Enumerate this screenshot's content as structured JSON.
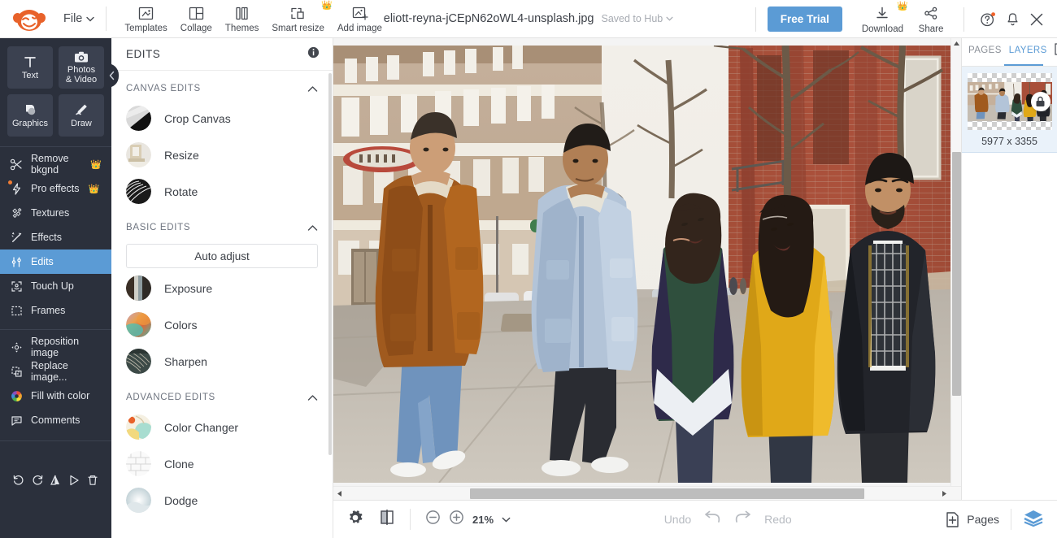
{
  "app": {
    "name": "PicMonkey",
    "logo_icon": "monkey-logo"
  },
  "topbar": {
    "file_menu": "File",
    "file_caret_icon": "chevron-down-icon",
    "tools": [
      {
        "label": "Templates",
        "icon": "templates-icon",
        "pro": false
      },
      {
        "label": "Collage",
        "icon": "collage-icon",
        "pro": false
      },
      {
        "label": "Themes",
        "icon": "themes-icon",
        "pro": false
      },
      {
        "label": "Smart resize",
        "icon": "smart-resize-icon",
        "pro": true
      },
      {
        "label": "Add image",
        "icon": "add-image-icon",
        "pro": false
      }
    ],
    "document_name": "eliott-reyna-jCEpN62oWL4-unsplash.jpg",
    "saved_status": "Saved to Hub",
    "saved_caret_icon": "chevron-down-icon",
    "free_trial": "Free Trial",
    "download": {
      "label": "Download",
      "icon": "download-icon",
      "pro": true
    },
    "share": {
      "label": "Share",
      "icon": "share-icon"
    },
    "help_icon": "help-circle-icon",
    "notifications_icon": "bell-icon",
    "close_icon": "close-icon",
    "accent_blue": "#5b9bd5",
    "crown_color": "#f5b33c"
  },
  "sidebar": {
    "tiles": [
      {
        "label": "Text",
        "icon": "text-icon"
      },
      {
        "label": "Photos\n& Video",
        "label_line1": "Photos",
        "label_line2": "& Video",
        "icon": "camera-icon"
      },
      {
        "label": "Graphics",
        "icon": "graphics-icon"
      },
      {
        "label": "Draw",
        "icon": "pencil-icon"
      }
    ],
    "items": [
      {
        "label": "Remove bkgnd",
        "icon": "scissors-icon",
        "pro": true,
        "active": false,
        "dot": false
      },
      {
        "label": "Pro effects",
        "icon": "lightning-icon",
        "pro": true,
        "active": false,
        "dot": true
      },
      {
        "label": "Textures",
        "icon": "textures-icon",
        "pro": false,
        "active": false,
        "dot": false
      },
      {
        "label": "Effects",
        "icon": "magic-wand-icon",
        "pro": false,
        "active": false,
        "dot": false
      },
      {
        "label": "Edits",
        "icon": "sliders-icon",
        "pro": false,
        "active": true,
        "dot": false
      },
      {
        "label": "Touch Up",
        "icon": "face-icon",
        "pro": false,
        "active": false,
        "dot": false
      },
      {
        "label": "Frames",
        "icon": "frame-icon",
        "pro": false,
        "active": false,
        "dot": false
      }
    ],
    "items2": [
      {
        "label": "Reposition image",
        "icon": "reposition-icon"
      },
      {
        "label": "Replace image...",
        "icon": "replace-image-icon"
      },
      {
        "label": "Fill with color",
        "icon": "color-wheel-icon"
      },
      {
        "label": "Comments",
        "icon": "comment-icon"
      }
    ],
    "bottom_tools": [
      {
        "icon": "undo-icon"
      },
      {
        "icon": "redo-icon"
      },
      {
        "icon": "flip-icon"
      },
      {
        "icon": "play-icon"
      },
      {
        "icon": "trash-icon"
      }
    ],
    "collapse_icon": "chevron-left-icon",
    "bg_color": "#2b303c"
  },
  "panel": {
    "title": "EDITS",
    "info_icon": "info-icon",
    "sections": [
      {
        "title": "CANVAS EDITS",
        "chevron_icon": "chevron-up-icon",
        "rows": [
          {
            "label": "Crop Canvas",
            "thumb": "crop-thumb"
          },
          {
            "label": "Resize",
            "thumb": "resize-thumb"
          },
          {
            "label": "Rotate",
            "thumb": "rotate-thumb"
          }
        ]
      },
      {
        "title": "BASIC EDITS",
        "chevron_icon": "chevron-up-icon",
        "auto_adjust": "Auto adjust",
        "rows": [
          {
            "label": "Exposure",
            "thumb": "exposure-thumb"
          },
          {
            "label": "Colors",
            "thumb": "colors-thumb"
          },
          {
            "label": "Sharpen",
            "thumb": "sharpen-thumb"
          }
        ]
      },
      {
        "title": "ADVANCED EDITS",
        "chevron_icon": "chevron-up-icon",
        "rows": [
          {
            "label": "Color Changer",
            "thumb": "color-changer-thumb"
          },
          {
            "label": "Clone",
            "thumb": "clone-thumb"
          },
          {
            "label": "Dodge",
            "thumb": "dodge-thumb"
          }
        ]
      }
    ]
  },
  "canvas": {
    "image_alt": "Five friends walking and laughing on a city sidewalk beside a red brick building",
    "hscroll_icon_left": "scroll-left-arrow",
    "hscroll_icon_right": "scroll-right-arrow",
    "vscroll_icon_up": "scroll-up-arrow",
    "vscroll_icon_down": "scroll-down-arrow"
  },
  "rightpanel": {
    "tabs": [
      {
        "label": "PAGES",
        "active": false
      },
      {
        "label": "LAYERS",
        "active": true
      }
    ],
    "close_icon": "close-box-icon",
    "layer": {
      "dimensions": "5977 x 3355",
      "lock_icon": "lock-icon"
    }
  },
  "bottombar": {
    "settings_icon": "gear-icon",
    "compare_icon": "compare-icon",
    "zoom_out_icon": "zoom-out-icon",
    "zoom_in_icon": "zoom-in-icon",
    "zoom_level": "21%",
    "zoom_caret_icon": "chevron-down-icon",
    "undo_label": "Undo",
    "undo_icon": "undo-arrow-icon",
    "redo_icon": "redo-arrow-icon",
    "redo_label": "Redo",
    "pages_label": "Pages",
    "pages_icon": "add-page-icon",
    "layers_icon": "layers-stack-icon"
  }
}
